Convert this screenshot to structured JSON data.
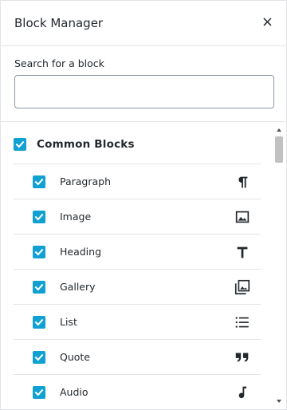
{
  "header": {
    "title": "Block Manager",
    "close_glyph": "×"
  },
  "search": {
    "label": "Search for a block",
    "value": "",
    "placeholder": ""
  },
  "category": {
    "title": "Common Blocks",
    "checked": true,
    "accent_color": "#11a0d2",
    "blocks": [
      {
        "label": "Paragraph",
        "icon": "paragraph-icon",
        "checked": true
      },
      {
        "label": "Image",
        "icon": "image-icon",
        "checked": true
      },
      {
        "label": "Heading",
        "icon": "heading-icon",
        "checked": true
      },
      {
        "label": "Gallery",
        "icon": "gallery-icon",
        "checked": true
      },
      {
        "label": "List",
        "icon": "list-icon",
        "checked": true
      },
      {
        "label": "Quote",
        "icon": "quote-icon",
        "checked": true
      },
      {
        "label": "Audio",
        "icon": "audio-icon",
        "checked": true
      }
    ]
  }
}
